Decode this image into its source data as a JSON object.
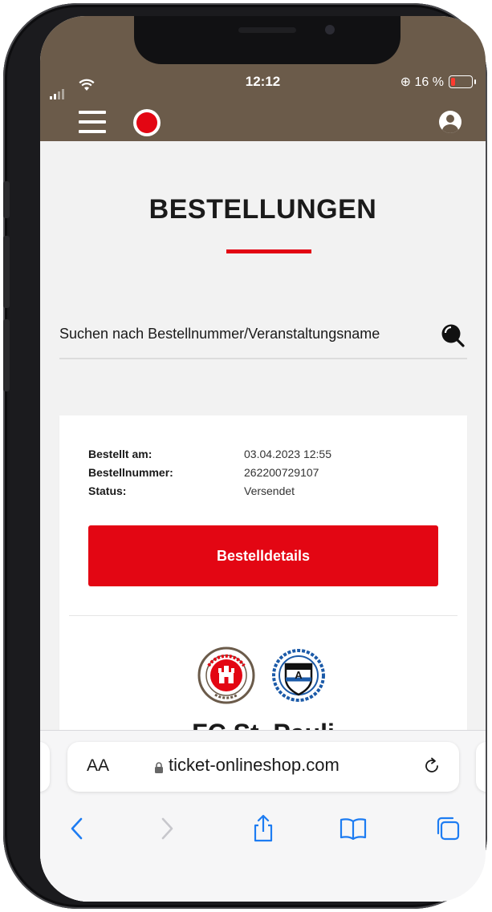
{
  "status_bar": {
    "time": "12:12",
    "battery_text": "⊕ 16 %"
  },
  "page": {
    "title": "BESTELLUNGEN"
  },
  "search": {
    "placeholder": "Suchen nach Bestellnummer/Veranstaltungsname"
  },
  "order": {
    "ordered_at_label": "Bestellt am:",
    "ordered_at_value": "03.04.2023 12:55",
    "order_number_label": "Bestellnummer:",
    "order_number_value": "262200729107",
    "status_label": "Status:",
    "status_value": "Versendet",
    "details_button": "Bestelldetails",
    "event_title": "FC St. Pauli"
  },
  "browser": {
    "aa_label": "AA",
    "url": "ticket-onlineshop.com"
  },
  "colors": {
    "brand_brown": "#6b5b4a",
    "accent_red": "#e30613",
    "bielefeld_blue": "#1b5aa8"
  }
}
